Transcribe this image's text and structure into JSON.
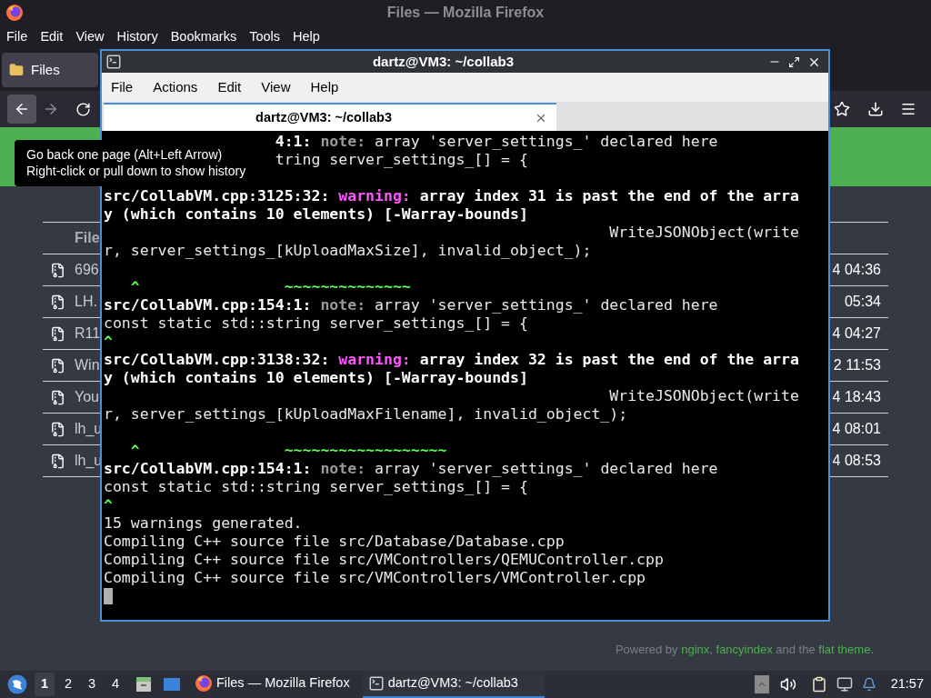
{
  "firefox": {
    "title": "Files — Mozilla Firefox",
    "menu": [
      "File",
      "Edit",
      "View",
      "History",
      "Bookmarks",
      "Tools",
      "Help"
    ],
    "tabs": [
      {
        "label": "Files",
        "selected": true
      }
    ],
    "table": {
      "header": "File",
      "rows": [
        {
          "name": "696",
          "date": "4 04:36"
        },
        {
          "name": "LH.",
          "date": "05:34"
        },
        {
          "name": "R11",
          "date": "4 04:27"
        },
        {
          "name": "Win",
          "date": "2 11:53"
        },
        {
          "name": "You",
          "date": "4 18:43"
        },
        {
          "name": "lh_u",
          "date": "4 08:01"
        },
        {
          "name": "lh_u",
          "date": "4 08:53"
        }
      ]
    },
    "footer": [
      {
        "kind": "text",
        "text": "Powered by "
      },
      {
        "kind": "link",
        "text": "nginx"
      },
      {
        "kind": "text",
        "text": ", "
      },
      {
        "kind": "link",
        "text": "fancyindex"
      },
      {
        "kind": "text",
        "text": " and the "
      },
      {
        "kind": "link",
        "text": "flat theme"
      },
      {
        "kind": "text",
        "text": "."
      }
    ]
  },
  "tooltip": {
    "lines": [
      "Go back one page (Alt+Left Arrow)",
      "Right-click or pull down to show history"
    ]
  },
  "terminal": {
    "title": "dartz@VM3: ~/collab3",
    "menu": [
      "File",
      "Actions",
      "Edit",
      "View",
      "Help"
    ],
    "tabs": [
      {
        "label": "dartz@VM3: ~/collab3",
        "selected": true
      }
    ],
    "lines": [
      {
        "kind": "covered",
        "segments": [
          {
            "kind": "bold",
            "text": "4:1: "
          },
          {
            "kind": "note",
            "text": "note: "
          },
          {
            "kind": "plain",
            "text": "array 'server_settings_' declared here"
          }
        ]
      },
      {
        "kind": "covered",
        "segments": [
          {
            "kind": "plain",
            "text": "tring server_settings_[] = {"
          }
        ]
      },
      {
        "kind": "blank"
      },
      {
        "kind": "full",
        "segments": [
          {
            "kind": "bold",
            "text": "src/CollabVM.cpp:3125:32: "
          },
          {
            "kind": "warning",
            "text": "warning: "
          },
          {
            "kind": "bold",
            "text": "array index 31 is past the end of the arra"
          }
        ]
      },
      {
        "kind": "full",
        "segments": [
          {
            "kind": "bold",
            "text": "y (which contains 10 elements) [-Warray-bounds]"
          }
        ]
      },
      {
        "kind": "full",
        "segments": [
          {
            "kind": "plain",
            "text": "                                                        WriteJSONObject(write"
          }
        ]
      },
      {
        "kind": "full",
        "segments": [
          {
            "kind": "plain",
            "text": "r, server_settings_[kUploadMaxSize], invalid_object_);"
          }
        ]
      },
      {
        "kind": "blank"
      },
      {
        "kind": "full",
        "segments": [
          {
            "kind": "marker",
            "text": "   ^                ~~~~~~~~~~~~~~"
          }
        ]
      },
      {
        "kind": "full",
        "segments": [
          {
            "kind": "bold",
            "text": "src/CollabVM.cpp:154:1: "
          },
          {
            "kind": "note",
            "text": "note: "
          },
          {
            "kind": "plain",
            "text": "array 'server_settings_' declared here"
          }
        ]
      },
      {
        "kind": "full",
        "segments": [
          {
            "kind": "plain",
            "text": "const static std::string server_settings_[] = {"
          }
        ]
      },
      {
        "kind": "full",
        "segments": [
          {
            "kind": "marker",
            "text": "^"
          }
        ]
      },
      {
        "kind": "full",
        "segments": [
          {
            "kind": "bold",
            "text": "src/CollabVM.cpp:3138:32: "
          },
          {
            "kind": "warning",
            "text": "warning: "
          },
          {
            "kind": "bold",
            "text": "array index 32 is past the end of the arra"
          }
        ]
      },
      {
        "kind": "full",
        "segments": [
          {
            "kind": "bold",
            "text": "y (which contains 10 elements) [-Warray-bounds]"
          }
        ]
      },
      {
        "kind": "full",
        "segments": [
          {
            "kind": "plain",
            "text": "                                                        WriteJSONObject(write"
          }
        ]
      },
      {
        "kind": "full",
        "segments": [
          {
            "kind": "plain",
            "text": "r, server_settings_[kUploadMaxFilename], invalid_object_);"
          }
        ]
      },
      {
        "kind": "blank"
      },
      {
        "kind": "full",
        "segments": [
          {
            "kind": "marker",
            "text": "   ^                ~~~~~~~~~~~~~~~~~~"
          }
        ]
      },
      {
        "kind": "full",
        "segments": [
          {
            "kind": "bold",
            "text": "src/CollabVM.cpp:154:1: "
          },
          {
            "kind": "note",
            "text": "note: "
          },
          {
            "kind": "plain",
            "text": "array 'server_settings_' declared here"
          }
        ]
      },
      {
        "kind": "full",
        "segments": [
          {
            "kind": "plain",
            "text": "const static std::string server_settings_[] = {"
          }
        ]
      },
      {
        "kind": "full",
        "segments": [
          {
            "kind": "marker",
            "text": "^"
          }
        ]
      },
      {
        "kind": "full",
        "segments": [
          {
            "kind": "plain",
            "text": "15 warnings generated."
          }
        ]
      },
      {
        "kind": "full",
        "segments": [
          {
            "kind": "plain",
            "text": "Compiling C++ source file src/Database/Database.cpp"
          }
        ]
      },
      {
        "kind": "full",
        "segments": [
          {
            "kind": "plain",
            "text": "Compiling C++ source file src/VMControllers/QEMUController.cpp"
          }
        ]
      },
      {
        "kind": "full",
        "segments": [
          {
            "kind": "plain",
            "text": "Compiling C++ source file src/VMControllers/VMController.cpp"
          }
        ]
      }
    ],
    "cursor": true
  },
  "taskbar": {
    "workspaces": [
      {
        "label": "1",
        "selected": true
      },
      {
        "label": "2",
        "selected": false
      },
      {
        "label": "3",
        "selected": false
      },
      {
        "label": "4",
        "selected": false
      }
    ],
    "tasks": [
      {
        "kind": "browser",
        "label": "Files — Mozilla Firefox",
        "selected": false
      },
      {
        "kind": "terminal",
        "label": "dartz@VM3: ~/collab3",
        "selected": true
      }
    ],
    "clock": "21:57"
  }
}
